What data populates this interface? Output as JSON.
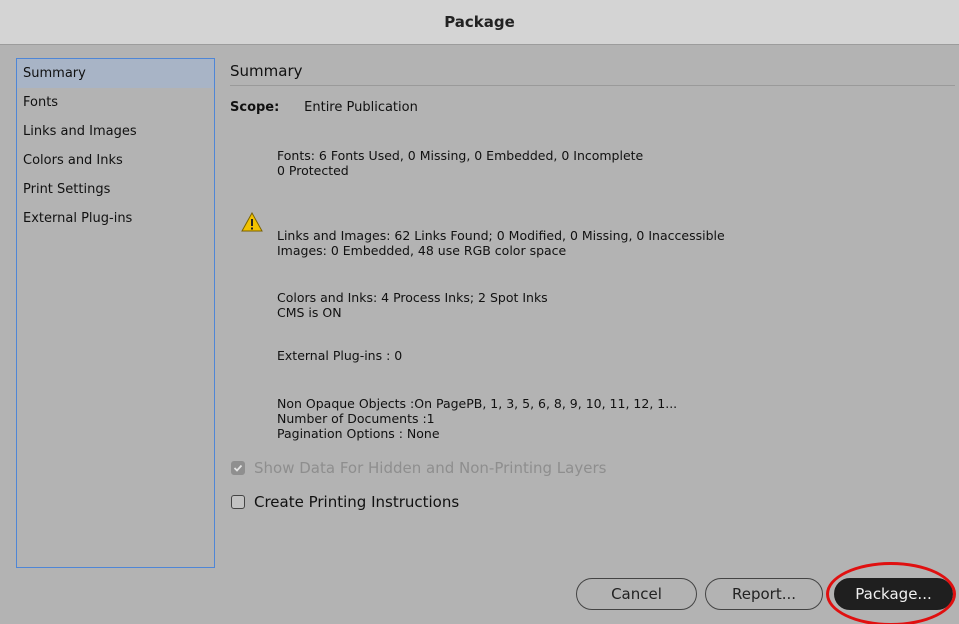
{
  "window": {
    "title": "Package"
  },
  "sidebar": {
    "items": [
      {
        "label": "Summary",
        "selected": true
      },
      {
        "label": "Fonts"
      },
      {
        "label": "Links and Images"
      },
      {
        "label": "Colors and Inks"
      },
      {
        "label": "Print Settings"
      },
      {
        "label": "External Plug-ins"
      }
    ]
  },
  "main": {
    "section_title": "Summary",
    "scope_label": "Scope:",
    "scope_value": "Entire Publication",
    "fonts_line1": "Fonts: 6 Fonts Used, 0 Missing, 0 Embedded, 0 Incomplete",
    "fonts_line2": "0 Protected",
    "links_line1": "Links and Images: 62 Links Found; 0 Modified, 0 Missing, 0 Inaccessible",
    "links_line2": "Images: 0 Embedded, 48 use RGB color space",
    "colors_line1": "Colors and Inks: 4 Process Inks; 2 Spot Inks",
    "colors_line2": "CMS is ON",
    "plugins_line": "External Plug-ins : 0",
    "misc_line1": "Non Opaque Objects :On PagePB, 1, 3, 5, 6, 8, 9, 10, 11, 12, 1...",
    "misc_line2": "Number of Documents :1",
    "misc_line3": "Pagination Options : None",
    "show_hidden_label": "Show Data For Hidden and Non-Printing Layers",
    "show_hidden_checked": true,
    "create_instructions_label": "Create Printing Instructions",
    "create_instructions_checked": false
  },
  "buttons": {
    "cancel": "Cancel",
    "report": "Report...",
    "package": "Package..."
  },
  "icons": {
    "warning": "warning-icon",
    "checkmark": "checkmark-icon"
  },
  "colors": {
    "selection_border": "#4f86d6",
    "annotation": "#e01010",
    "warning": "#f2c200"
  }
}
